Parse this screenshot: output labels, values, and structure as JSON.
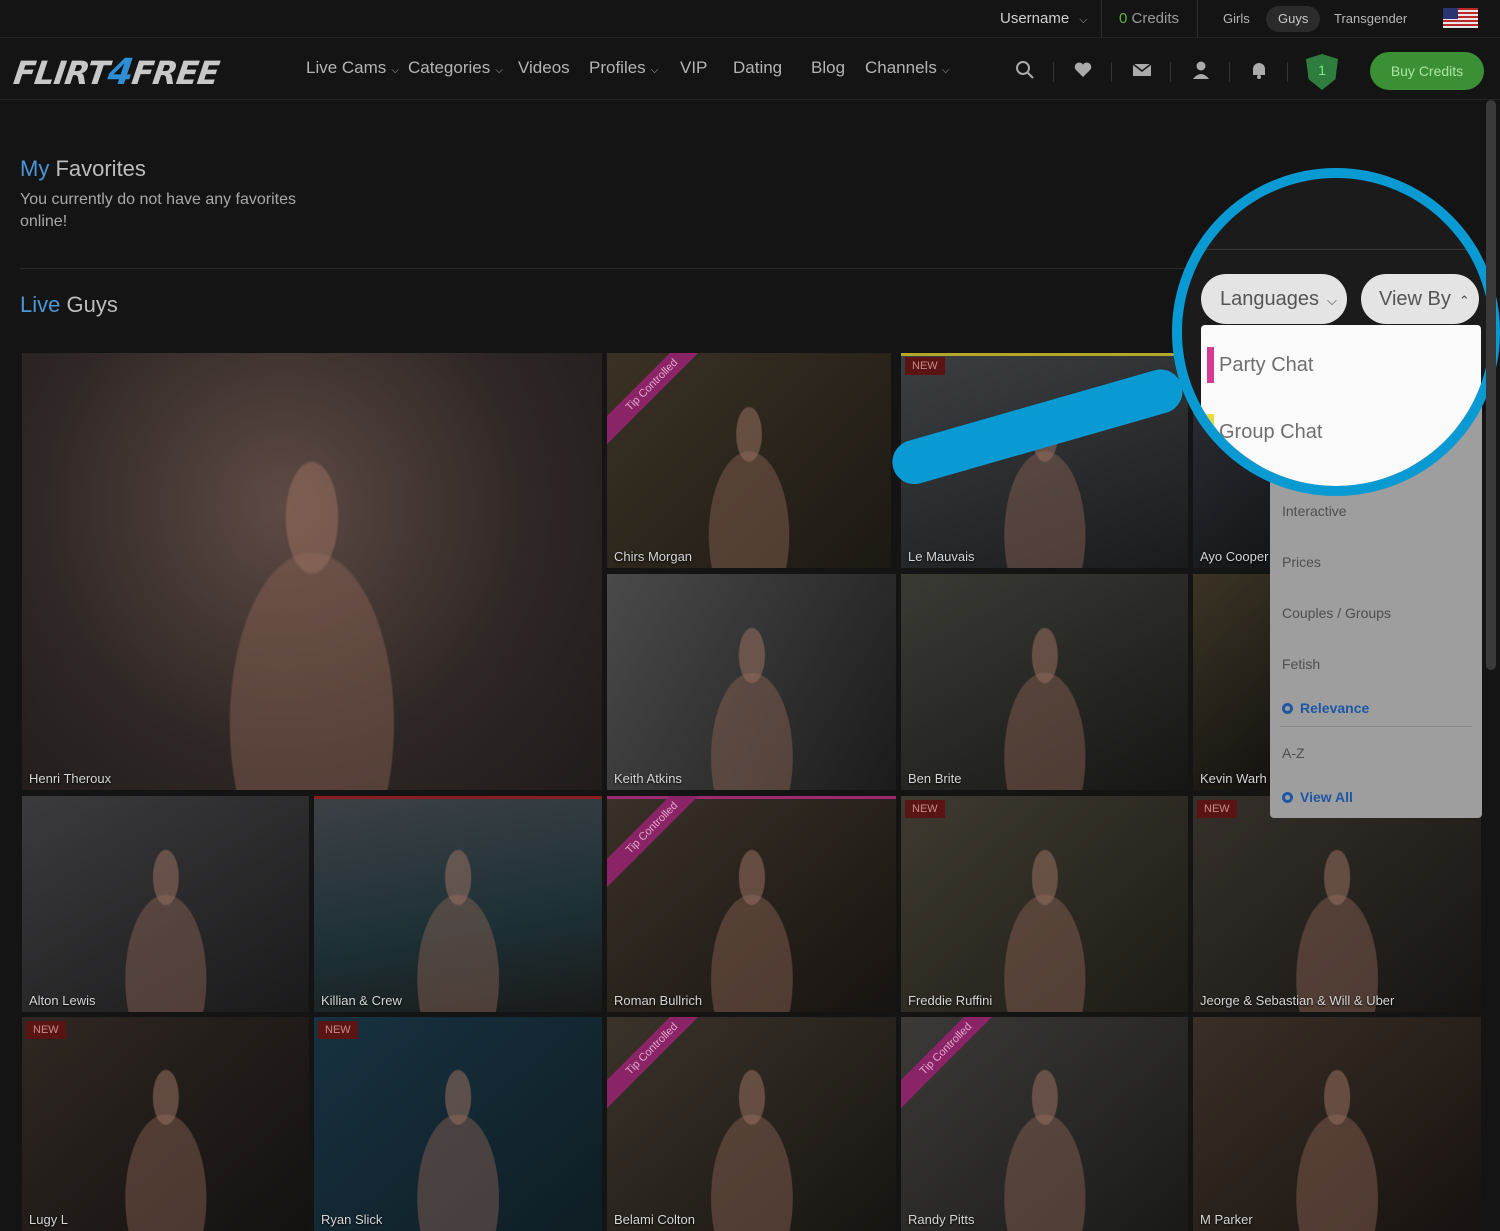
{
  "topbar": {
    "username": "Username",
    "credits_count": "0",
    "credits_label": " Credits",
    "genders": [
      "Girls",
      "Guys",
      "Transgender"
    ]
  },
  "nav": {
    "logo_part1": "FLIRT",
    "logo_four": "4",
    "logo_part2": "FREE",
    "items": [
      "Live Cams",
      "Categories",
      "Videos",
      "Profiles",
      "VIP",
      "Dating",
      "Blog",
      "Channels"
    ],
    "shield_count": "1",
    "buy_credits": "Buy Credits"
  },
  "favorites": {
    "title_accent": "My",
    "title_rest": " Favorites",
    "message": "You currently do not have any favorites online!"
  },
  "live": {
    "title_accent": "Live",
    "title_rest": " Guys"
  },
  "filters": {
    "languages": "Languages",
    "view_by": "View By",
    "options_highlight": [
      "Party Chat",
      "Group Chat"
    ],
    "options": [
      "Interactive",
      "Prices",
      "Couples / Groups",
      "Fetish"
    ],
    "sort_selected": "Relevance",
    "sort_other": "A-Z",
    "view_selected": "View All"
  },
  "badges": {
    "new": "NEW",
    "tip": "Tip Controlled"
  },
  "performers": [
    "Henri Theroux",
    "Chirs Morgan",
    "Le Mauvais",
    "Ayo Cooper",
    "Keith Atkins",
    "Ben Brite",
    "Kevin Warh",
    "Alton Lewis",
    "Killian & Crew",
    "Roman Bullrich",
    "Freddie Ruffini",
    "Jeorge & Sebastian & Will & Uber",
    "Lugy L",
    "Ryan Slick",
    "Belami Colton",
    "Randy Pitts",
    "M Parker"
  ],
  "colors": {
    "accent_blue": "#4a96d6",
    "buy_green": "#3b8f35",
    "callout_blue": "#0a9ad3",
    "party_chat": "#d63a93",
    "group_chat": "#e8dc3a",
    "tip_magenta": "#8a2467"
  }
}
